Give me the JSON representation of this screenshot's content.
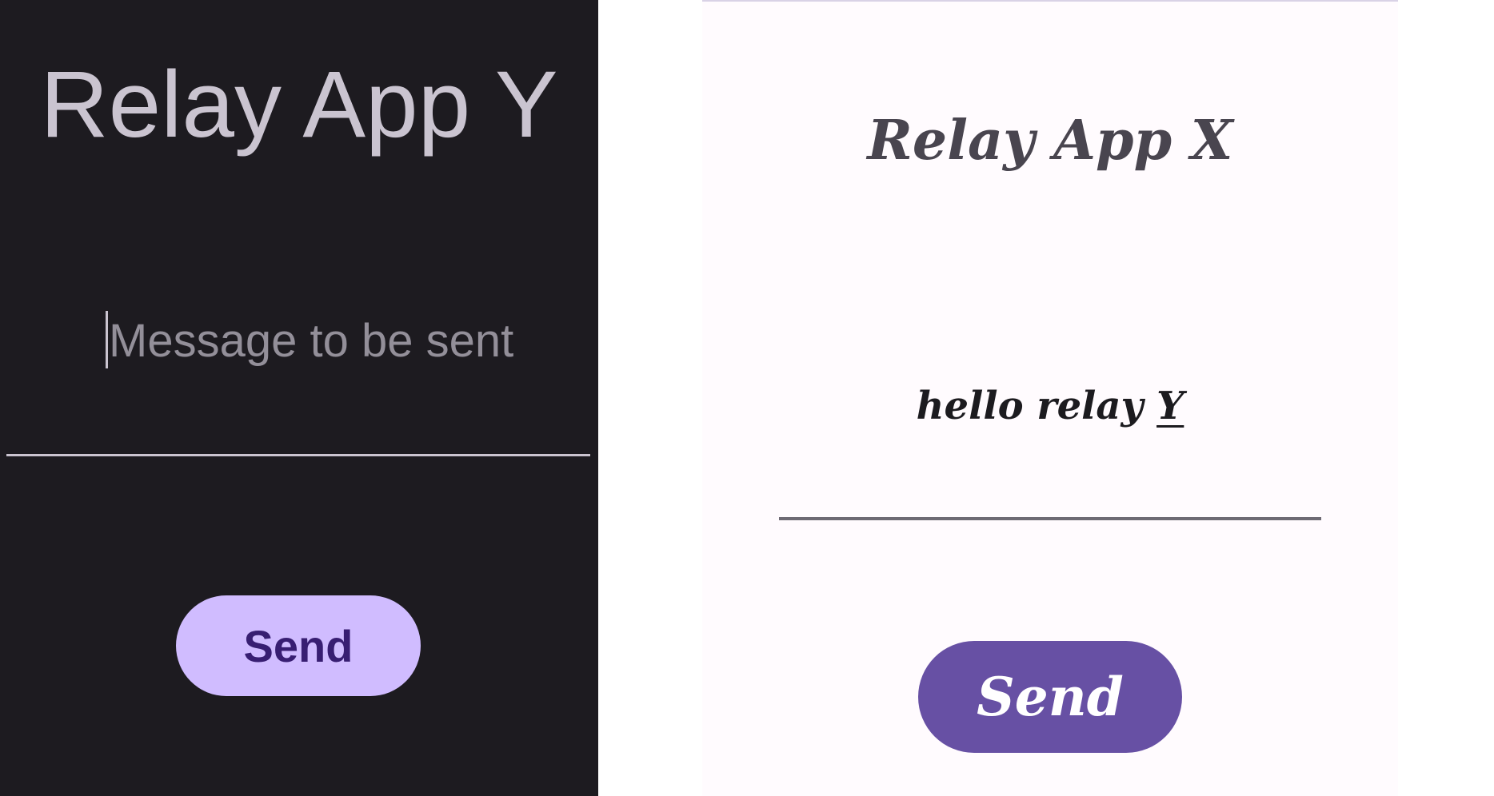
{
  "relay_app_y": {
    "title": "Relay App Y",
    "message_input": {
      "value": "",
      "placeholder": "Message to be sent"
    },
    "send_label": "Send",
    "colors": {
      "background": "#1d1b20",
      "title": "#cac4d0",
      "placeholder": "#938f99",
      "button": "#d0bcff",
      "button_text": "#381e72"
    }
  },
  "relay_app_x": {
    "title": "Relay App X",
    "message_input": {
      "value_prefix": "hello relay ",
      "value_misspelled_word": "Y"
    },
    "send_label": "Send",
    "colors": {
      "background": "#fffbfe",
      "title": "#49454f",
      "text": "#1c1b1f",
      "button": "#6750a4",
      "button_text": "#ffffff"
    }
  }
}
